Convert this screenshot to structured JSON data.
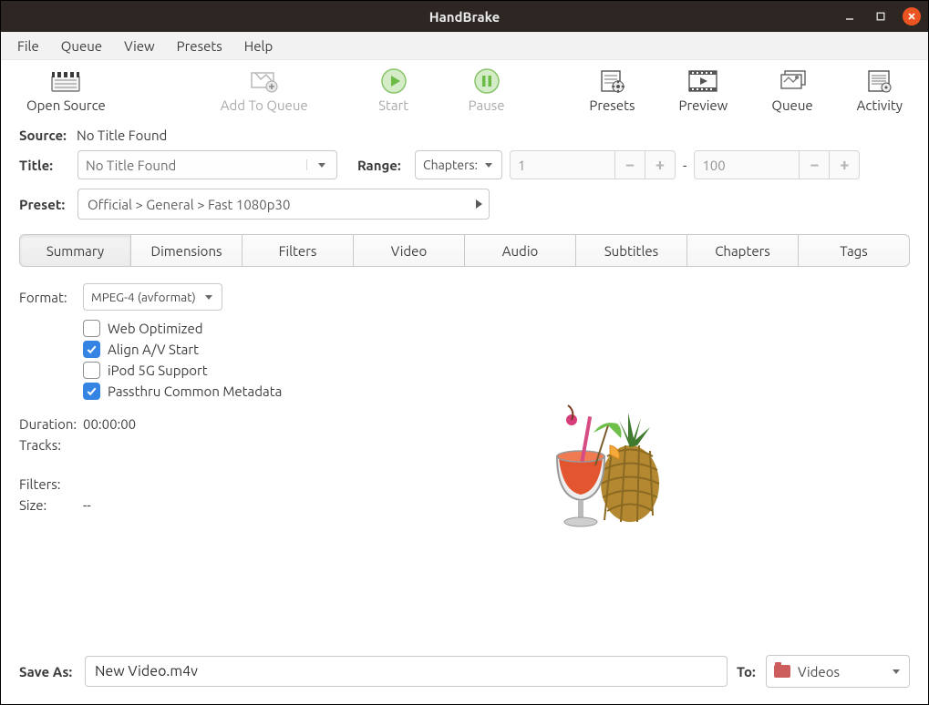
{
  "window": {
    "title": "HandBrake"
  },
  "menubar": [
    "File",
    "Queue",
    "View",
    "Presets",
    "Help"
  ],
  "toolbar": {
    "open_source": "Open Source",
    "add_to_queue": "Add To Queue",
    "start": "Start",
    "pause": "Pause",
    "presets": "Presets",
    "preview": "Preview",
    "queue": "Queue",
    "activity": "Activity"
  },
  "source": {
    "label": "Source:",
    "value": "No Title Found"
  },
  "title": {
    "label": "Title:",
    "value": "No Title Found"
  },
  "range": {
    "label": "Range:",
    "mode": "Chapters:",
    "start": "1",
    "end": "100",
    "dash": "-"
  },
  "preset": {
    "label": "Preset:",
    "value": "Official > General > Fast 1080p30"
  },
  "tabs": [
    "Summary",
    "Dimensions",
    "Filters",
    "Video",
    "Audio",
    "Subtitles",
    "Chapters",
    "Tags"
  ],
  "active_tab": 0,
  "summary": {
    "format_label": "Format:",
    "format_value": "MPEG-4 (avformat)",
    "checks": {
      "web_optimized": {
        "label": "Web Optimized",
        "checked": false
      },
      "align_av_start": {
        "label": "Align A/V Start",
        "checked": true
      },
      "ipod_5g": {
        "label": "iPod 5G Support",
        "checked": false
      },
      "passthru_meta": {
        "label": "Passthru Common Metadata",
        "checked": true
      }
    },
    "duration_label": "Duration:",
    "duration_value": "00:00:00",
    "tracks_label": "Tracks:",
    "tracks_value": "",
    "filters_label": "Filters:",
    "filters_value": "",
    "size_label": "Size:",
    "size_value": "--"
  },
  "save_as": {
    "label": "Save As:",
    "value": "New Video.m4v"
  },
  "dest": {
    "label": "To:",
    "value": "Videos"
  }
}
